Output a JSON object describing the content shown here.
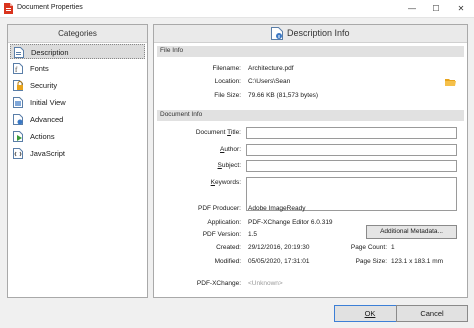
{
  "window": {
    "title": "Document Properties",
    "minimize_glyph": "—",
    "maximize_glyph": "☐",
    "close_glyph": "✕"
  },
  "categories": {
    "header": "Categories",
    "items": [
      {
        "label": "Description",
        "icon": "description-icon",
        "selected": true
      },
      {
        "label": "Fonts",
        "icon": "fonts-icon"
      },
      {
        "label": "Security",
        "icon": "security-icon"
      },
      {
        "label": "Initial View",
        "icon": "initial-view-icon"
      },
      {
        "label": "Advanced",
        "icon": "advanced-icon"
      },
      {
        "label": "Actions",
        "icon": "actions-icon"
      },
      {
        "label": "JavaScript",
        "icon": "javascript-icon"
      }
    ]
  },
  "panel": {
    "title": "Description Info",
    "file_info": {
      "group_label": "File Info",
      "filename_label": "Filename:",
      "filename_value": "Architecture.pdf",
      "location_label": "Location:",
      "location_value": "C:\\Users\\Sean",
      "filesize_label": "File Size:",
      "filesize_value": "79.66 KB (81,573 bytes)"
    },
    "document_info": {
      "group_label": "Document Info",
      "title_label_pre": "Document ",
      "title_label_u": "T",
      "title_label_post": "itle:",
      "title_value": "",
      "author_label_u": "A",
      "author_label_post": "uthor:",
      "author_value": "",
      "subject_label_u": "S",
      "subject_label_post": "ubject:",
      "subject_value": "",
      "keywords_label_u": "K",
      "keywords_label_post": "eywords:",
      "keywords_value": "",
      "producer_label": "PDF Producer:",
      "producer_value": "Adobe ImageReady",
      "application_label": "Application:",
      "application_value": "PDF-XChange Editor 6.0.319",
      "version_label": "PDF Version:",
      "version_value": "1.5",
      "created_label": "Created:",
      "created_value": "29/12/2016, 20:19:30",
      "modified_label": "Modified:",
      "modified_value": "05/05/2020, 17:31:01",
      "page_count_label": "Page Count:",
      "page_count_value": "1",
      "page_size_label": "Page Size:",
      "page_size_value": "123.1 x 183.1 mm",
      "xchange_label": "PDF-XChange:",
      "xchange_value": "<Unknown>",
      "additional_metadata_button": "Additional Metadata..."
    }
  },
  "buttons": {
    "ok": "OK",
    "cancel": "Cancel"
  },
  "colors": {
    "accent_red": "#d9341e",
    "folder_yellow": "#e8a41c",
    "selection_gray": "#dcdcdc"
  }
}
